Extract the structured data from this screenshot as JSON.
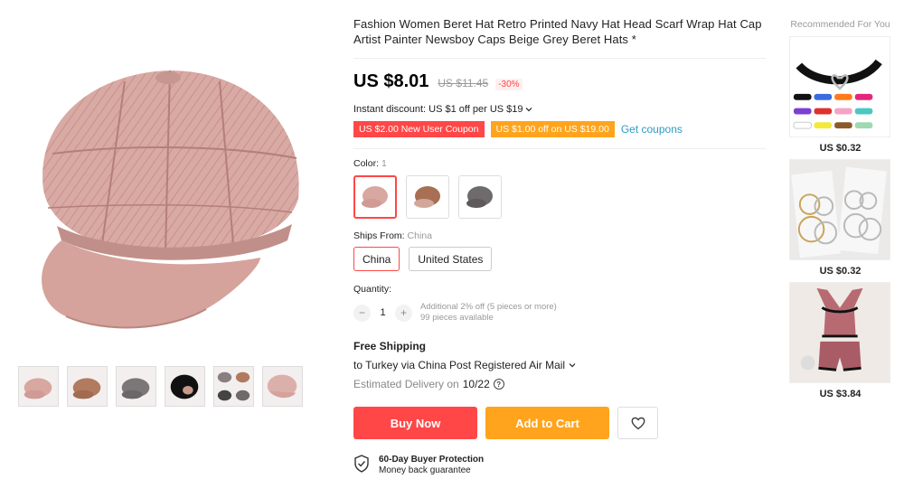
{
  "product": {
    "title": "Fashion Women Beret Hat Retro Printed Navy Hat Head Scarf Wrap Hat Cap Artist Painter Newsboy Caps Beige Grey Beret Hats *",
    "price": "US $8.01",
    "original_price": "US $11.45",
    "discount": "-30%",
    "instant_discount": "Instant discount: US $1 off per US $19",
    "coupons": {
      "new_user": "US $2.00 New User Coupon",
      "store": "US $1.00 off on US $19.00",
      "get_coupons": "Get coupons"
    },
    "color": {
      "label": "Color:",
      "selected": "1",
      "options": [
        "pink",
        "brown",
        "grey"
      ]
    },
    "ships_from": {
      "label": "Ships From:",
      "selected": "China",
      "options": [
        "China",
        "United States"
      ]
    },
    "quantity": {
      "label": "Quantity:",
      "value": "1",
      "minus": "−",
      "plus": "+",
      "note1": "Additional 2% off (5 pieces or more)",
      "note2": "99 pieces available"
    },
    "shipping": {
      "free": "Free Shipping",
      "to": "to Turkey via China Post Registered Air Mail",
      "estimated_label": "Estimated Delivery on",
      "estimated_date": "10/22",
      "help": "?"
    },
    "buttons": {
      "buy_now": "Buy Now",
      "add_to_cart": "Add to Cart"
    },
    "protection": {
      "title": "60-Day Buyer Protection",
      "subtitle": "Money back guarantee"
    }
  },
  "gallery": {
    "thumbs": [
      "thumb-pink",
      "thumb-brown",
      "thumb-grey",
      "thumb-black",
      "thumb-grid",
      "thumb-pink-side"
    ]
  },
  "recommended": {
    "title": "Recommended For You",
    "items": [
      {
        "price": "US $0.32",
        "icon": "choker-necklace"
      },
      {
        "price": "US $0.32",
        "icon": "hoop-earrings"
      },
      {
        "price": "US $3.84",
        "icon": "satin-pajamas"
      }
    ]
  },
  "colors": {
    "accent_red": "#ff4747",
    "accent_orange": "#ffa41c",
    "link_blue": "#2e9cc3"
  }
}
